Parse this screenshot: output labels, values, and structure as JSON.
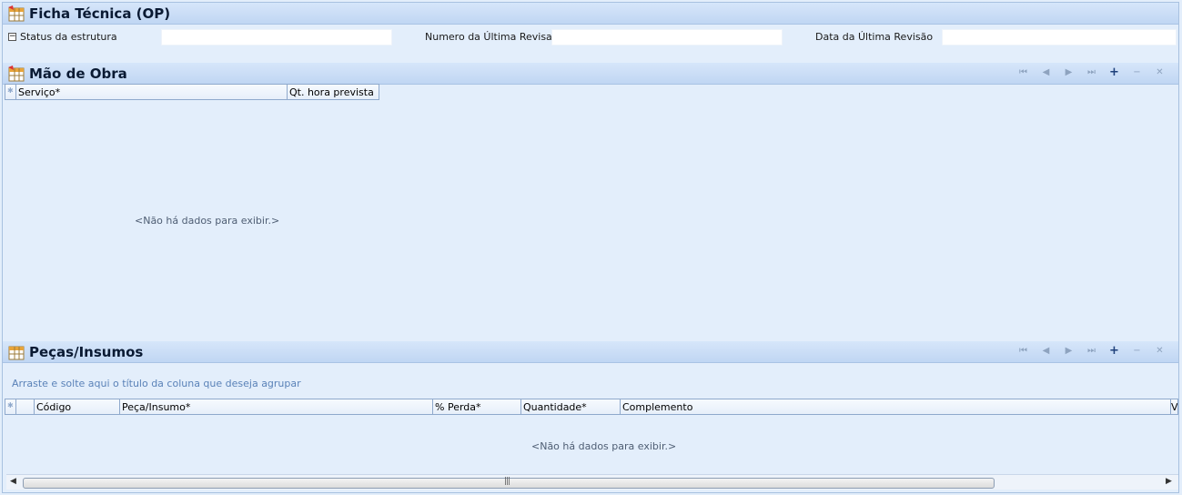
{
  "ficha": {
    "title": "Ficha Técnica (OP)",
    "fields": [
      {
        "label": "Status da estrutura",
        "value": ""
      },
      {
        "label": "Numero da Última Revisao",
        "value": ""
      },
      {
        "label": "Data da Última Revisão",
        "value": ""
      }
    ]
  },
  "mao_de_obra": {
    "title": "Mão de Obra",
    "columns": [
      "Serviço*",
      "Qt. hora prevista"
    ],
    "empty_text": "<Não há dados para exibir.>"
  },
  "pecas": {
    "title": "Peças/Insumos",
    "group_hint": "Arraste e solte aqui o título da coluna que deseja agrupar",
    "columns": [
      "Código",
      "Peça/Insumo*",
      "% Perda*",
      "Quantidade*",
      "Complemento",
      "V"
    ],
    "empty_text": "<Não há dados para exibir.>"
  },
  "navigator": {
    "first": "⏮",
    "prev": "◀",
    "next": "▶",
    "last": "⏭",
    "add": "+",
    "remove": "−",
    "cancel": "✕"
  },
  "scrollbar": {
    "grip": "|||",
    "left": "◀",
    "right": "▶"
  },
  "colors": {
    "accent": "#c0d6f3",
    "background": "#e3eefb"
  }
}
